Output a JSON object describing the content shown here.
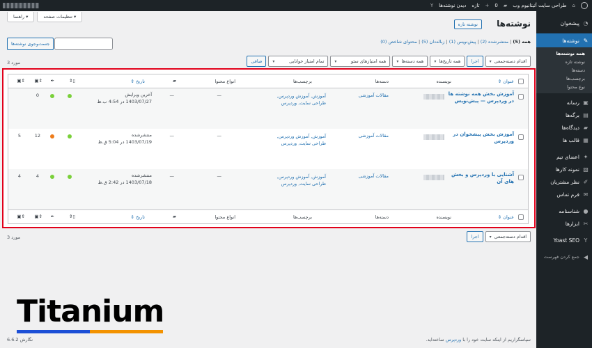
{
  "adminbar": {
    "site_name": "طراحی سایت آتیتانیوم وب",
    "comments_count": "0",
    "new_label": "تازه",
    "view_posts": "دیدن نوشته‌ها"
  },
  "sidebar": {
    "items": [
      {
        "label": "پیشخوان",
        "icon": "dashboard-icon",
        "glyph": "◔"
      },
      {
        "label": "نوشته‌ها",
        "icon": "pin-icon",
        "glyph": "✎",
        "current": true
      },
      {
        "label": "رسانه",
        "icon": "media-icon",
        "glyph": "▣"
      },
      {
        "label": "برگه‌ها",
        "icon": "pages-icon",
        "glyph": "▤"
      },
      {
        "label": "دیدگاه‌ها",
        "icon": "comments-icon",
        "glyph": "▰"
      },
      {
        "label": "قالب ها",
        "icon": "templates-icon",
        "glyph": "▦"
      },
      {
        "label": "اعضای تیم",
        "icon": "team-icon",
        "glyph": "✦"
      },
      {
        "label": "نمونه کارها",
        "icon": "portfolio-icon",
        "glyph": "▧"
      },
      {
        "label": "نظر مشتریان",
        "icon": "testimonials-icon",
        "glyph": "✐"
      },
      {
        "label": "فرم تماس",
        "icon": "mail-icon",
        "glyph": "✉"
      },
      {
        "label": "شناسنامه",
        "icon": "user-icon",
        "glyph": "●"
      },
      {
        "label": "ابزارها",
        "icon": "tools-icon",
        "glyph": "✂"
      },
      {
        "label": "Yoast SEO",
        "icon": "yoast-icon",
        "glyph": "Y"
      },
      {
        "label": "جمع کردن فهرست",
        "icon": "collapse-icon",
        "glyph": "◀"
      }
    ],
    "submenu": [
      "همه نوشته‌ها",
      "نوشته تازه",
      "دسته‌ها",
      "برچسب‌ها",
      "نوع محتوا"
    ]
  },
  "screen_options": "تنظیمات صفحه",
  "help": "راهنما",
  "page_title": "نوشته‌ها",
  "add_new": "نوشته تازه",
  "filters": {
    "all": "همه",
    "all_count": "(5)",
    "published": "منتشرشده",
    "published_count": "(2)",
    "draft": "پیش‌نویس",
    "draft_count": "(1)",
    "trash": "زباله‌دان",
    "trash_count": "(5)",
    "cornerstone": "محتوای شاخص",
    "cornerstone_count": "(0)"
  },
  "search_button": "جست‌وجوی نوشته‌ها",
  "tablenav": {
    "bulk_actions": "اقدام دسته‌جمعی",
    "apply": "اجرا",
    "all_dates": "همه تاریخ‌ها",
    "all_categories": "همه دسته‌ها",
    "seo_scores": "همه امتیازهای سئو",
    "readability": "تمام امتیاز خوانایی",
    "filter": "صافی",
    "items_count": "3 مورد"
  },
  "columns": {
    "title": "عنوان",
    "author": "نویسنده",
    "categories": "دسته‌ها",
    "tags": "برچسب‌ها",
    "content_type": "انواع محتوا",
    "date": "تاریخ"
  },
  "posts": [
    {
      "title": "آموزش بخش همه نوشته ها در وردپرس — پیش‌نویس",
      "category": "مقالات آموزشی",
      "tags": "آموزش, آموزش وردپرس, طراحی سایت, وردپرس",
      "content_type": "—",
      "comments": "—",
      "date_status": "آخرین ویرایش",
      "date": "1403/07/27 در 4:54 ب.ظ",
      "seo_color": "#7ad03a",
      "read_color": "#7ad03a",
      "links_in": "",
      "links_out": "0"
    },
    {
      "title": "آموزش بخش پیشخوان در وردپرس",
      "category": "مقالات آموزشی",
      "tags": "آموزش, آموزش وردپرس, طراحی سایت, وردپرس",
      "content_type": "—",
      "comments": "—",
      "date_status": "منتشرشده",
      "date": "1403/07/19 در 5:04 ق.ظ",
      "seo_color": "#7ad03a",
      "read_color": "#ee7c1b",
      "links_in": "5",
      "links_out": "12"
    },
    {
      "title": "آشنایی با وردپرس و بخش های آن",
      "category": "مقالات آموزشی",
      "tags": "آموزش, آموزش وردپرس, طراحی سایت, وردپرس",
      "content_type": "—",
      "comments": "—",
      "date_status": "منتشرشده",
      "date": "1403/07/18 در 2:42 ق.ظ",
      "seo_color": "#7ad03a",
      "read_color": "#7ad03a",
      "links_in": "4",
      "links_out": "4"
    }
  ],
  "footer": {
    "thanks": "سپاسگزاریم از اینکه سایت خود را با",
    "wordpress": "وردپرس",
    "thanks_end": "ساخته‌اید.",
    "version": "نگارش 6.6.2"
  },
  "logo": {
    "text": "Titanium"
  }
}
